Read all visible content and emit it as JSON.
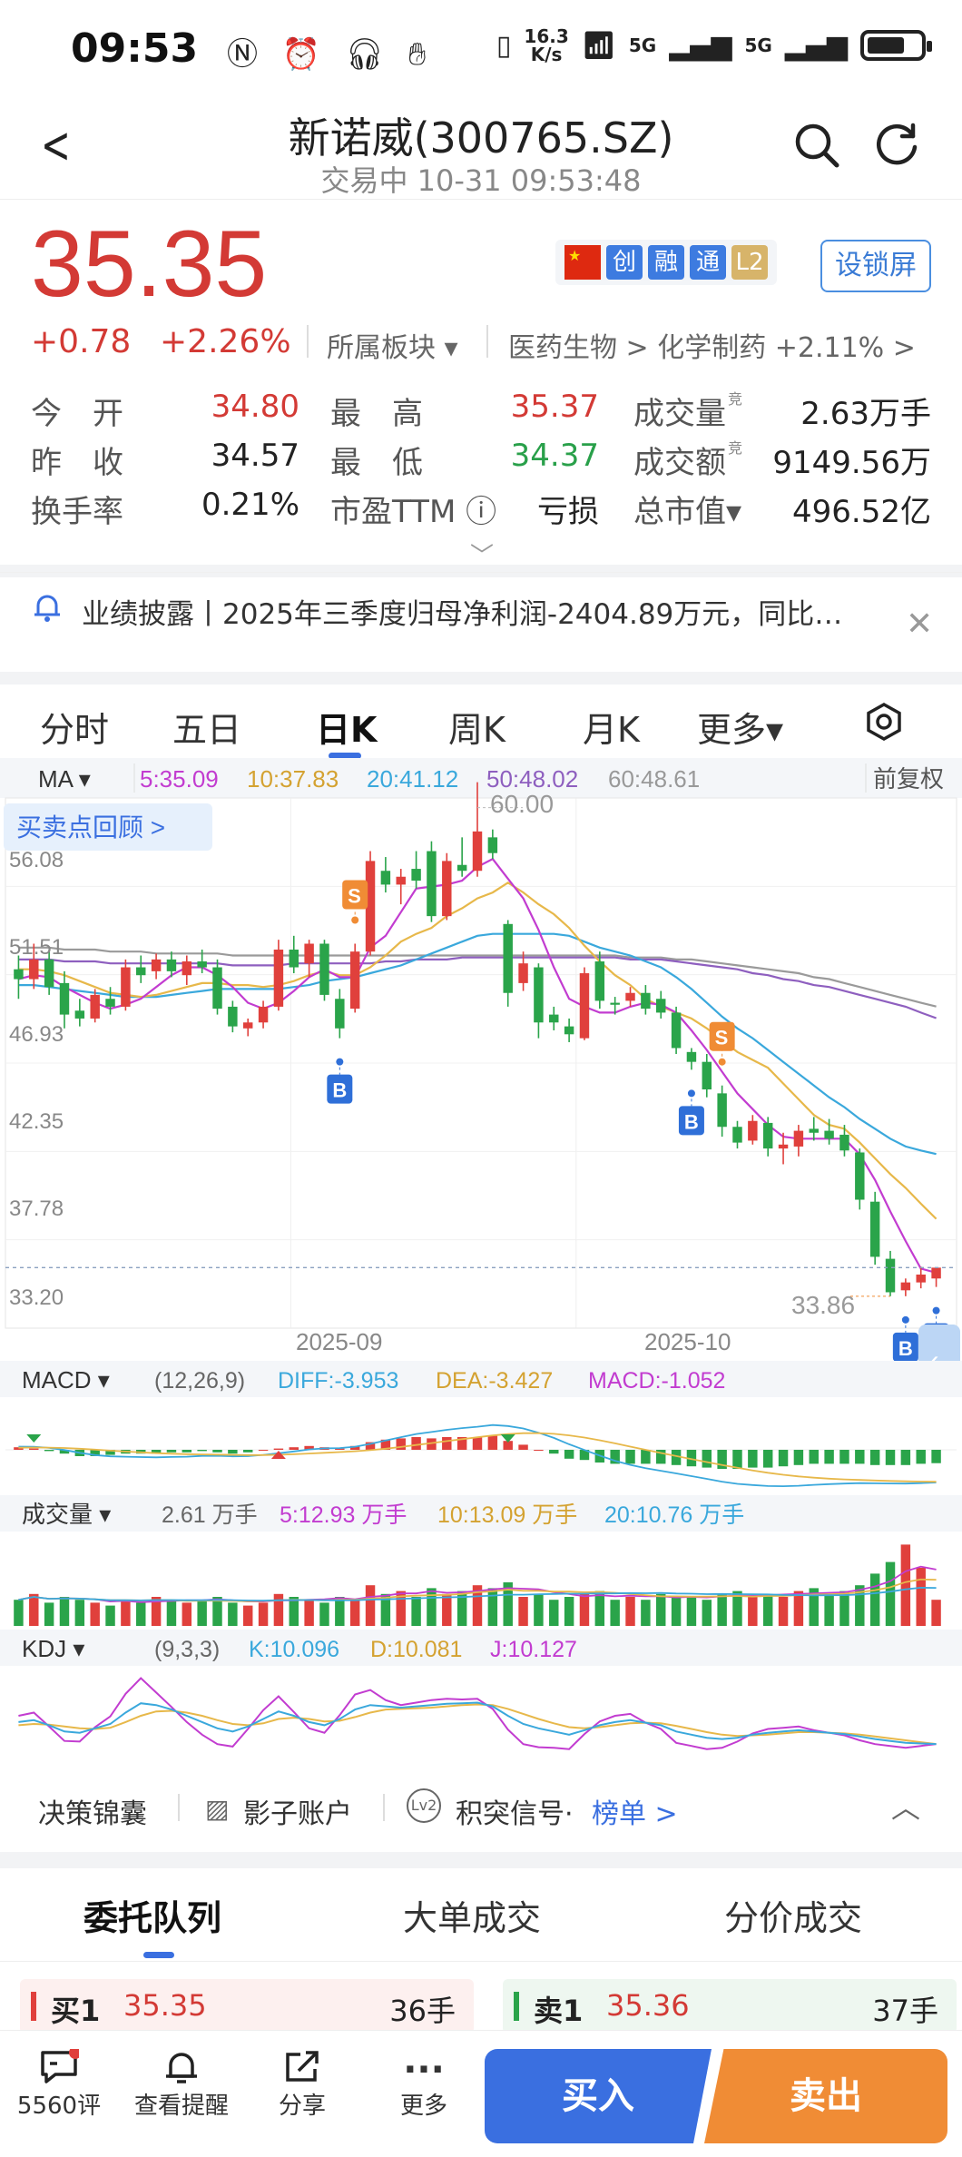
{
  "status": {
    "time": "09:53",
    "net_speed_top": "16.3",
    "net_speed_bottom": "K/s",
    "sig1": "5G",
    "sig2": "5G"
  },
  "header": {
    "title": "新诺威(300765.SZ)",
    "subtitle": "交易中 10-31 09:53:48"
  },
  "quote": {
    "price": "35.35",
    "change": "+0.78",
    "change_pct": "+2.26%",
    "sector_label": "所属板块 ▾",
    "sector_path": "医药生物 > 化学制药 +2.11% >",
    "badges": [
      "创",
      "融",
      "通",
      "L2"
    ],
    "lock_label": "设锁屏",
    "rows": [
      [
        {
          "k": "今　开",
          "v": "34.80",
          "c": "red"
        },
        {
          "k": "最　高",
          "v": "35.37",
          "c": "red"
        },
        {
          "k": "成交量",
          "v": "2.63万手",
          "c": "dark",
          "sup": "竞"
        }
      ],
      [
        {
          "k": "昨　收",
          "v": "34.57",
          "c": "dark"
        },
        {
          "k": "最　低",
          "v": "34.37",
          "c": "green"
        },
        {
          "k": "成交额",
          "v": "9149.56万",
          "c": "dark",
          "sup": "竞"
        }
      ],
      [
        {
          "k": "换手率",
          "v": "0.21%",
          "c": "dark"
        },
        {
          "k": "市盈TTM ⓘ",
          "v": "亏损",
          "c": "dark"
        },
        {
          "k": "总市值▾",
          "v": "496.52亿",
          "c": "dark"
        }
      ]
    ]
  },
  "notice": {
    "text": "业绩披露丨2025年三季度归母净利润-2404.89万元，同比…"
  },
  "ktabs": [
    "分时",
    "五日",
    "日K",
    "周K",
    "月K",
    "更多▾"
  ],
  "ma_bar": {
    "label": "MA ▾",
    "ma5": "5:35.09",
    "ma10": "10:37.83",
    "ma20": "20:41.12",
    "ma50": "50:48.02",
    "ma60": "60:48.61",
    "adjust": "前复权"
  },
  "review_button": "买卖点回顾 >",
  "chart_data": {
    "type": "candlestick",
    "y_ticks": [
      "56.08",
      "51.51",
      "46.93",
      "42.35",
      "37.78",
      "33.20"
    ],
    "x_ticks": [
      "2025-09",
      "2025-10"
    ],
    "high_label": "60.00",
    "low_label": "33.86",
    "ylim": [
      33.2,
      58.0
    ],
    "candles": [
      [
        50.5,
        51.2,
        49.0,
        50.0
      ],
      [
        50.0,
        51.8,
        49.5,
        51.0
      ],
      [
        51.0,
        51.5,
        49.2,
        49.6
      ],
      [
        49.8,
        50.4,
        47.5,
        48.2
      ],
      [
        48.4,
        49.0,
        47.6,
        48.0
      ],
      [
        48.0,
        49.5,
        47.8,
        49.2
      ],
      [
        49.0,
        49.6,
        48.2,
        48.6
      ],
      [
        48.6,
        51.0,
        48.4,
        50.6
      ],
      [
        50.6,
        51.2,
        49.8,
        50.2
      ],
      [
        50.4,
        51.3,
        50.0,
        51.0
      ],
      [
        51.0,
        51.4,
        50.1,
        50.4
      ],
      [
        50.2,
        51.2,
        49.7,
        50.9
      ],
      [
        50.9,
        51.5,
        50.3,
        50.6
      ],
      [
        50.6,
        51.0,
        48.2,
        48.5
      ],
      [
        48.6,
        48.9,
        47.3,
        47.6
      ],
      [
        47.5,
        48.0,
        47.1,
        47.8
      ],
      [
        47.8,
        48.9,
        47.5,
        48.6
      ],
      [
        48.6,
        52.0,
        48.4,
        51.5
      ],
      [
        51.5,
        52.2,
        50.3,
        50.6
      ],
      [
        50.8,
        52.0,
        50.1,
        51.8
      ],
      [
        51.8,
        52.0,
        48.9,
        49.2
      ],
      [
        49.0,
        49.5,
        47.0,
        47.5
      ],
      [
        48.5,
        51.8,
        48.3,
        51.4
      ],
      [
        51.4,
        56.5,
        51.2,
        56.0
      ],
      [
        55.5,
        56.2,
        54.4,
        54.8
      ],
      [
        54.8,
        55.6,
        53.8,
        55.2
      ],
      [
        55.6,
        56.5,
        54.6,
        55.0
      ],
      [
        56.5,
        57.0,
        52.9,
        53.2
      ],
      [
        53.2,
        56.4,
        53.0,
        56.0
      ],
      [
        55.8,
        57.2,
        55.2,
        55.5
      ],
      [
        55.5,
        60.0,
        55.2,
        57.5
      ],
      [
        57.2,
        57.6,
        56.1,
        56.4
      ],
      [
        52.8,
        53.0,
        48.6,
        49.3
      ],
      [
        49.8,
        51.4,
        49.4,
        50.8
      ],
      [
        50.6,
        50.8,
        47.0,
        47.8
      ],
      [
        48.2,
        48.6,
        47.4,
        47.8
      ],
      [
        47.6,
        48.0,
        46.8,
        47.2
      ],
      [
        47.0,
        50.6,
        46.9,
        50.3
      ],
      [
        50.9,
        51.4,
        48.5,
        48.9
      ],
      [
        48.8,
        49.1,
        48.2,
        48.7
      ],
      [
        48.9,
        49.6,
        48.6,
        49.3
      ],
      [
        49.3,
        49.7,
        48.2,
        48.5
      ],
      [
        49.0,
        49.4,
        48.0,
        48.3
      ],
      [
        48.3,
        48.6,
        46.2,
        46.5
      ],
      [
        46.3,
        46.5,
        45.4,
        45.8
      ],
      [
        45.8,
        46.2,
        44.0,
        44.4
      ],
      [
        44.2,
        44.6,
        42.0,
        42.5
      ],
      [
        42.5,
        42.8,
        41.4,
        41.7
      ],
      [
        41.8,
        43.1,
        41.6,
        42.8
      ],
      [
        42.7,
        43.0,
        41.0,
        41.4
      ],
      [
        41.4,
        42.2,
        40.6,
        41.6
      ],
      [
        41.5,
        42.6,
        41.0,
        42.3
      ],
      [
        42.4,
        43.0,
        41.8,
        42.2
      ],
      [
        42.3,
        42.9,
        41.6,
        41.9
      ],
      [
        42.1,
        42.6,
        41.0,
        41.3
      ],
      [
        41.2,
        41.4,
        38.3,
        38.8
      ],
      [
        38.7,
        39.2,
        35.5,
        35.9
      ],
      [
        35.8,
        36.2,
        33.9,
        34.1
      ],
      [
        34.2,
        34.8,
        33.9,
        34.6
      ],
      [
        34.6,
        35.4,
        34.3,
        35.0
      ],
      [
        34.8,
        35.37,
        34.37,
        35.35
      ]
    ],
    "ma5": [
      50.0,
      50.2,
      50.1,
      49.6,
      49.2,
      48.8,
      48.5,
      48.7,
      49.0,
      49.6,
      50.2,
      50.6,
      50.6,
      50.2,
      49.6,
      48.8,
      48.5,
      48.8,
      49.4,
      50.1,
      50.5,
      50.1,
      50.1,
      51.6,
      52.2,
      53.4,
      54.6,
      54.7,
      54.8,
      55.0,
      55.7,
      56.1,
      55.1,
      54.1,
      52.5,
      50.6,
      49.0,
      48.6,
      48.3,
      48.3,
      48.6,
      48.8,
      48.7,
      48.3,
      47.4,
      46.4,
      45.3,
      44.2,
      43.4,
      42.6,
      42.0,
      41.9,
      41.9,
      41.9,
      41.9,
      41.1,
      39.8,
      38.2,
      36.7,
      35.3,
      35.09
    ],
    "ma10": [
      50.5,
      50.5,
      50.4,
      50.2,
      49.9,
      49.6,
      49.3,
      49.2,
      49.1,
      49.2,
      49.4,
      49.6,
      49.8,
      49.8,
      49.7,
      49.7,
      49.6,
      49.7,
      49.9,
      50.2,
      50.4,
      50.2,
      50.2,
      50.6,
      51.2,
      51.9,
      52.3,
      52.6,
      53.2,
      53.6,
      54.1,
      54.4,
      54.9,
      54.4,
      53.8,
      53.3,
      52.6,
      51.7,
      50.9,
      50.2,
      49.7,
      49.0,
      48.6,
      48.3,
      48.0,
      47.5,
      46.9,
      46.3,
      45.9,
      45.5,
      44.7,
      43.9,
      43.1,
      42.6,
      42.4,
      41.7,
      40.9,
      40.1,
      39.4,
      38.6,
      37.83
    ],
    "ma20": [
      49.7,
      49.7,
      49.6,
      49.5,
      49.4,
      49.3,
      49.2,
      49.1,
      49.1,
      49.1,
      49.2,
      49.3,
      49.4,
      49.5,
      49.5,
      49.5,
      49.5,
      49.5,
      49.6,
      49.7,
      49.9,
      50.0,
      50.1,
      50.3,
      50.5,
      50.7,
      51.0,
      51.3,
      51.6,
      51.9,
      52.2,
      52.3,
      52.3,
      52.3,
      52.3,
      52.3,
      52.2,
      51.9,
      51.6,
      51.4,
      51.2,
      50.9,
      50.6,
      50.1,
      49.5,
      48.8,
      48.1,
      47.5,
      47.0,
      46.4,
      45.8,
      45.2,
      44.6,
      44.0,
      43.5,
      42.9,
      42.4,
      41.9,
      41.5,
      41.3,
      41.12
    ],
    "ma50": [
      51.0,
      51.0,
      51.0,
      50.9,
      50.9,
      50.9,
      50.8,
      50.8,
      50.8,
      50.8,
      50.8,
      50.8,
      50.8,
      50.8,
      50.7,
      50.7,
      50.7,
      50.7,
      50.8,
      50.8,
      50.8,
      50.8,
      50.8,
      50.8,
      50.9,
      50.9,
      51.0,
      51.0,
      51.0,
      51.1,
      51.1,
      51.1,
      51.1,
      51.1,
      51.1,
      51.1,
      51.1,
      51.1,
      51.1,
      51.1,
      51.0,
      51.0,
      51.0,
      50.9,
      50.8,
      50.7,
      50.6,
      50.5,
      50.3,
      50.2,
      50.0,
      49.9,
      49.7,
      49.6,
      49.4,
      49.2,
      49.0,
      48.8,
      48.6,
      48.3,
      48.02
    ],
    "ma60": [
      51.6,
      51.6,
      51.6,
      51.5,
      51.5,
      51.5,
      51.4,
      51.4,
      51.4,
      51.3,
      51.3,
      51.3,
      51.3,
      51.3,
      51.2,
      51.2,
      51.2,
      51.2,
      51.2,
      51.2,
      51.2,
      51.2,
      51.2,
      51.2,
      51.2,
      51.2,
      51.2,
      51.2,
      51.2,
      51.2,
      51.2,
      51.2,
      51.2,
      51.2,
      51.2,
      51.2,
      51.2,
      51.2,
      51.2,
      51.2,
      51.1,
      51.1,
      51.1,
      51.0,
      51.0,
      50.9,
      50.8,
      50.7,
      50.6,
      50.5,
      50.4,
      50.3,
      50.1,
      50.0,
      49.8,
      49.6,
      49.4,
      49.2,
      49.0,
      48.8,
      48.61
    ],
    "signals": [
      {
        "t": "B",
        "i": 21
      },
      {
        "t": "S",
        "i": 22
      },
      {
        "t": "S",
        "i": 46
      },
      {
        "t": "B",
        "i": 44
      },
      {
        "t": "B",
        "i": 58
      },
      {
        "t": "B",
        "i": 60
      }
    ],
    "macd_bar": {
      "label": "MACD ▾",
      "params": "(12,26,9)",
      "diff": "DIFF:-3.953",
      "dea": "DEA:-3.427",
      "macd": "MACD:-1.052"
    },
    "macd": [
      0.2,
      0.1,
      -0.1,
      -0.3,
      -0.5,
      -0.5,
      -0.4,
      -0.3,
      -0.3,
      -0.3,
      -0.2,
      -0.2,
      -0.1,
      -0.2,
      -0.3,
      -0.2,
      0.0,
      0.1,
      0.2,
      0.3,
      0.2,
      0.1,
      0.3,
      0.6,
      0.8,
      0.9,
      1.0,
      0.9,
      1.0,
      1.0,
      1.0,
      1.1,
      0.7,
      0.4,
      0.0,
      -0.3,
      -0.7,
      -0.8,
      -1.0,
      -1.1,
      -1.1,
      -1.1,
      -1.1,
      -1.2,
      -1.3,
      -1.4,
      -1.5,
      -1.5,
      -1.4,
      -1.4,
      -1.3,
      -1.2,
      -1.1,
      -1.1,
      -1.1,
      -1.1,
      -1.2,
      -1.2,
      -1.2,
      -1.1,
      -1.052
    ],
    "vol_bar": {
      "label": "成交量 ▾",
      "v": "2.61 万手",
      "v5": "5:12.93 万手",
      "v10": "10:13.09 万手",
      "v20": "20:10.76 万手"
    },
    "volume": [
      9,
      11,
      8,
      10,
      9,
      8,
      7,
      9,
      8,
      10,
      9,
      8,
      9,
      10,
      8,
      7,
      8,
      11,
      10,
      9,
      8,
      10,
      9,
      14,
      11,
      12,
      10,
      13,
      11,
      12,
      14,
      13,
      15,
      10,
      11,
      9,
      10,
      11,
      12,
      9,
      10,
      9,
      11,
      10,
      10,
      9,
      11,
      12,
      10,
      11,
      10,
      12,
      13,
      11,
      12,
      14,
      18,
      22,
      28,
      20,
      9
    ],
    "kdj_bar": {
      "label": "KDJ ▾",
      "params": "(9,3,3)",
      "k": "K:10.096",
      "d": "D:10.081",
      "j": "J:10.127"
    },
    "kdj_k": [
      45,
      48,
      40,
      30,
      28,
      35,
      42,
      60,
      75,
      72,
      65,
      55,
      45,
      35,
      30,
      38,
      50,
      62,
      55,
      45,
      40,
      50,
      65,
      72,
      70,
      68,
      70,
      72,
      74,
      75,
      76,
      70,
      55,
      42,
      35,
      30,
      25,
      32,
      40,
      45,
      48,
      44,
      40,
      30,
      25,
      20,
      18,
      20,
      25,
      28,
      30,
      32,
      30,
      28,
      26,
      22,
      18,
      15,
      12,
      11,
      10.1
    ],
    "kdj_d": [
      40,
      42,
      41,
      38,
      35,
      34,
      36,
      45,
      55,
      62,
      63,
      60,
      55,
      48,
      42,
      40,
      43,
      50,
      52,
      50,
      46,
      47,
      53,
      60,
      65,
      66,
      67,
      68,
      70,
      72,
      73,
      72,
      66,
      58,
      50,
      43,
      37,
      35,
      37,
      40,
      43,
      44,
      43,
      39,
      34,
      29,
      25,
      23,
      24,
      25,
      27,
      29,
      29,
      28,
      27,
      25,
      22,
      19,
      16,
      13,
      10.1
    ],
    "kdj_j": [
      55,
      60,
      38,
      15,
      14,
      37,
      54,
      90,
      115,
      92,
      69,
      45,
      25,
      10,
      6,
      34,
      64,
      86,
      61,
      35,
      28,
      56,
      89,
      96,
      80,
      72,
      76,
      80,
      82,
      81,
      82,
      66,
      33,
      10,
      5,
      4,
      2,
      26,
      46,
      55,
      58,
      44,
      34,
      12,
      7,
      2,
      4,
      14,
      27,
      34,
      36,
      38,
      32,
      28,
      24,
      16,
      10,
      7,
      4,
      7,
      10.1
    ],
    "colors": {
      "up": "#e0403c",
      "down": "#2aa44a",
      "ma5": "#c23cd0",
      "ma10": "#e7b84a",
      "ma20": "#3aa8dc",
      "ma50": "#8e5fbf",
      "ma60": "#9a9a9a",
      "signal_b": "#2f6fd8",
      "signal_s": "#f08c35"
    }
  },
  "panel": {
    "links": [
      "决策锦囊",
      "影子账户",
      "积突信号·",
      "榜单 >"
    ],
    "order_tabs": [
      "委托队列",
      "大单成交",
      "分价成交"
    ],
    "buy1": {
      "label": "买1",
      "price": "35.35",
      "qty": "36手"
    },
    "sell1": {
      "label": "卖1",
      "price": "35.36",
      "qty": "37手"
    }
  },
  "bottombar": {
    "items": [
      {
        "icon": "comment-icon",
        "label": "5560评"
      },
      {
        "icon": "bell-icon",
        "label": "查看提醒"
      },
      {
        "icon": "share-icon",
        "label": "分享"
      },
      {
        "icon": "more-icon",
        "label": "更多"
      }
    ],
    "buy": "买入",
    "sell": "卖出"
  }
}
